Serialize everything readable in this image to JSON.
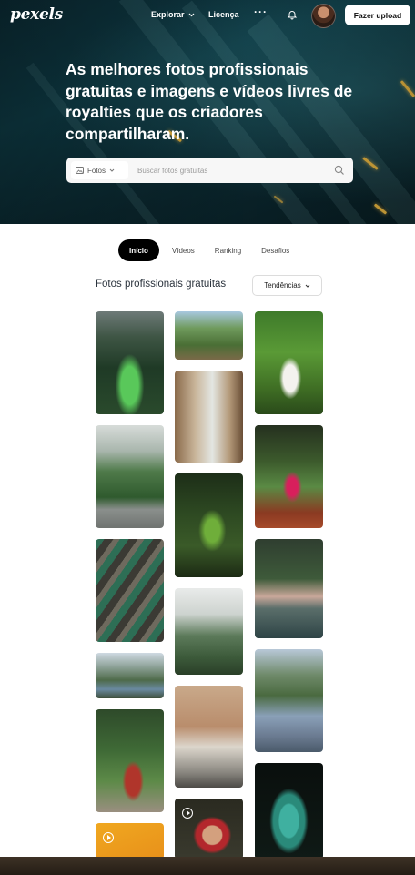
{
  "header": {
    "logo": "pexels",
    "nav": {
      "explore_label": "Explorar",
      "license_label": "Licença",
      "more_label": "···"
    },
    "upload_label": "Fazer upload",
    "icons": [
      "chevron-down-icon",
      "bell-icon",
      "avatar"
    ]
  },
  "hero": {
    "title": "As melhores fotos profissionais gratuitas e imagens e vídeos livres de royalties que os criadores compartilharam.",
    "search": {
      "type_label": "Fotos",
      "placeholder": "Buscar fotos gratuitas"
    }
  },
  "tabs": [
    {
      "label": "Início",
      "active": true
    },
    {
      "label": "Vídeos",
      "active": false
    },
    {
      "label": "Ranking",
      "active": false
    },
    {
      "label": "Desafios",
      "active": false
    }
  ],
  "section": {
    "title": "Fotos profissionais gratuitas",
    "sort_label": "Tendências"
  },
  "photos": [
    {
      "id": "photo-aerial-stadium",
      "video": false
    },
    {
      "id": "photo-misty-mountain-road",
      "video": false
    },
    {
      "id": "photo-market-street",
      "video": false
    },
    {
      "id": "photo-river-canyon",
      "video": false
    },
    {
      "id": "photo-tropical-doorway",
      "video": false
    },
    {
      "id": "photo-orange-video",
      "video": true
    },
    {
      "id": "photo-garden-bench",
      "video": false
    },
    {
      "id": "photo-cozy-interior",
      "video": false
    },
    {
      "id": "photo-parrots",
      "video": false
    },
    {
      "id": "photo-foggy-cabins",
      "video": false
    },
    {
      "id": "photo-coffee-shop-building",
      "video": false
    },
    {
      "id": "photo-woman-portrait-video",
      "video": true
    },
    {
      "id": "photo-woman-banana-leaves",
      "video": false
    },
    {
      "id": "photo-dancer-field",
      "video": false
    },
    {
      "id": "photo-lakeside-village",
      "video": false
    },
    {
      "id": "photo-hillside-town",
      "video": false
    },
    {
      "id": "photo-green-lizard",
      "video": false
    }
  ],
  "colors": {
    "hero_bg": "#0e3a44",
    "active_tab_bg": "#000000",
    "upload_bg": "#ffffff"
  }
}
